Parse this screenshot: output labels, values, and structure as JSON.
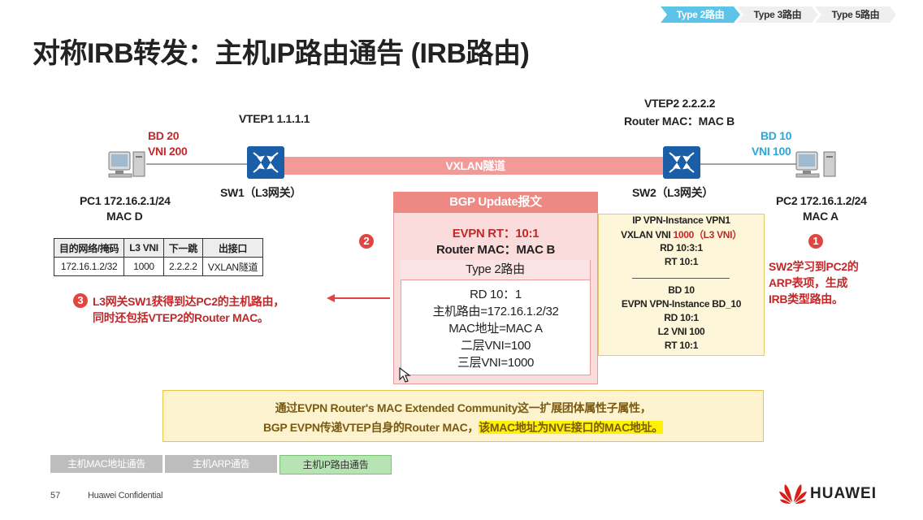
{
  "tabs": [
    {
      "label": "Type 2路由",
      "active": true
    },
    {
      "label": "Type 3路由",
      "active": false
    },
    {
      "label": "Type 5路由",
      "active": false
    }
  ],
  "title": "对称IRB转发：主机IP路由通告 (IRB路由)",
  "pc1": {
    "name": "PC1 172.16.2.1/24",
    "mac": "MAC D"
  },
  "pc2": {
    "name": "PC2 172.16.1.2/24",
    "mac": "MAC A"
  },
  "bd_left": {
    "bd": "BD 20",
    "vni": "VNI 200"
  },
  "bd_right": {
    "bd": "BD 10",
    "vni": "VNI 100"
  },
  "vtep1": "VTEP1 1.1.1.1",
  "vtep2": {
    "ip": "VTEP2 2.2.2.2",
    "mac": "Router MAC：MAC B"
  },
  "sw1_label": "SW1（L3网关）",
  "sw2_label": "SW2（L3网关）",
  "tunnel_label": "VXLAN隧道",
  "route_table": {
    "headers": [
      "目的网络/掩码",
      "L3 VNI",
      "下一跳",
      "出接口"
    ],
    "rows": [
      [
        "172.16.1.2/32",
        "1000",
        "2.2.2.2",
        "VXLAN隧道"
      ]
    ]
  },
  "step3": {
    "num": "3",
    "line1": "L3网关SW1获得到达PC2的主机路由，",
    "line2": "同时还包括VTEP2的Router MAC。"
  },
  "step2": {
    "num": "2"
  },
  "bgp": {
    "head": "BGP Update报文",
    "evpn_rt": "EVPN RT：10:1",
    "router_mac": "Router MAC：MAC B",
    "type2_head": "Type 2路由",
    "rd": "RD 10：1",
    "host_route": "主机路由=172.16.1.2/32",
    "mac_addr": "MAC地址=MAC A",
    "l2vni": "二层VNI=100",
    "l3vni": "三层VNI=1000"
  },
  "sw2_config": {
    "l1": "IP VPN-Instance VPN1",
    "l2a": "VXLAN VNI ",
    "l2b": "1000（L3 VNI）",
    "l3": "RD 10:3:1",
    "l4": "RT 10:1",
    "l5": "BD 10",
    "l6": "EVPN VPN-Instance BD_10",
    "l7": "RD 10:1",
    "l8": "L2 VNI 100",
    "l9": "RT 10:1"
  },
  "step1": {
    "num": "1",
    "line1": "SW2学习到PC2的",
    "line2": "ARP表项，生成",
    "line3": "IRB类型路由。"
  },
  "note": {
    "line1": "通过EVPN Router's MAC Extended Community这一扩展团体属性子属性，",
    "line2a": "BGP EVPN传递VTEP自身的Router MAC，",
    "line2b": "该MAC地址为NVE接口的MAC地址。"
  },
  "bottom_tabs": [
    {
      "label": "主机MAC地址通告",
      "active": false
    },
    {
      "label": "主机ARP通告",
      "active": false
    },
    {
      "label": "主机IP路由通告",
      "active": true
    }
  ],
  "page_number": "57",
  "confidential": "Huawei Confidential",
  "brand": "HUAWEI",
  "colors": {
    "accent_red": "#c0282a",
    "accent_cyan": "#2aa7d6",
    "tab_active": "#5bc4e8",
    "tunnel": "#f19a98"
  }
}
